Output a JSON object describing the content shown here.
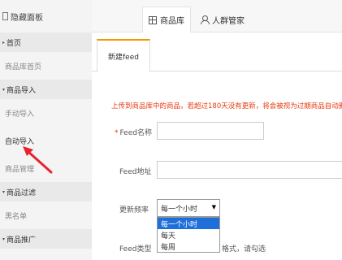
{
  "sidebar": {
    "toggle_label": "隐藏面板",
    "groups": [
      {
        "label": "首页",
        "items": [
          "商品库首页"
        ]
      },
      {
        "label": "商品导入",
        "items": [
          "手动导入",
          "自动导入",
          "商品管理"
        ]
      },
      {
        "label": "商品过滤",
        "items": [
          "黑名单"
        ]
      },
      {
        "label": "商品推广",
        "items": []
      }
    ]
  },
  "topbar": {
    "tabs": [
      {
        "label": "商品库",
        "icon": "grid-icon"
      },
      {
        "label": "人群管家",
        "icon": "person-icon"
      }
    ]
  },
  "main": {
    "subtab": "新建feed",
    "notice": "上传到商品库中的商品，若超过180天没有更新，将会被视为过期商品自动删除。",
    "feed_name_label": "Feed名称",
    "feed_url_label": "Feed地址",
    "frequency_label": "更新频率",
    "frequency_value": "每一个小时",
    "frequency_options": [
      "每一个小时",
      "每天",
      "每周"
    ],
    "feed_type_label": "Feed类型",
    "feed_type_hint": "格式，请勾选"
  },
  "colors": {
    "accent": "#f39800",
    "notice": "#e8380d",
    "selection": "#1e6fd9",
    "arrow": "#e8232e"
  }
}
